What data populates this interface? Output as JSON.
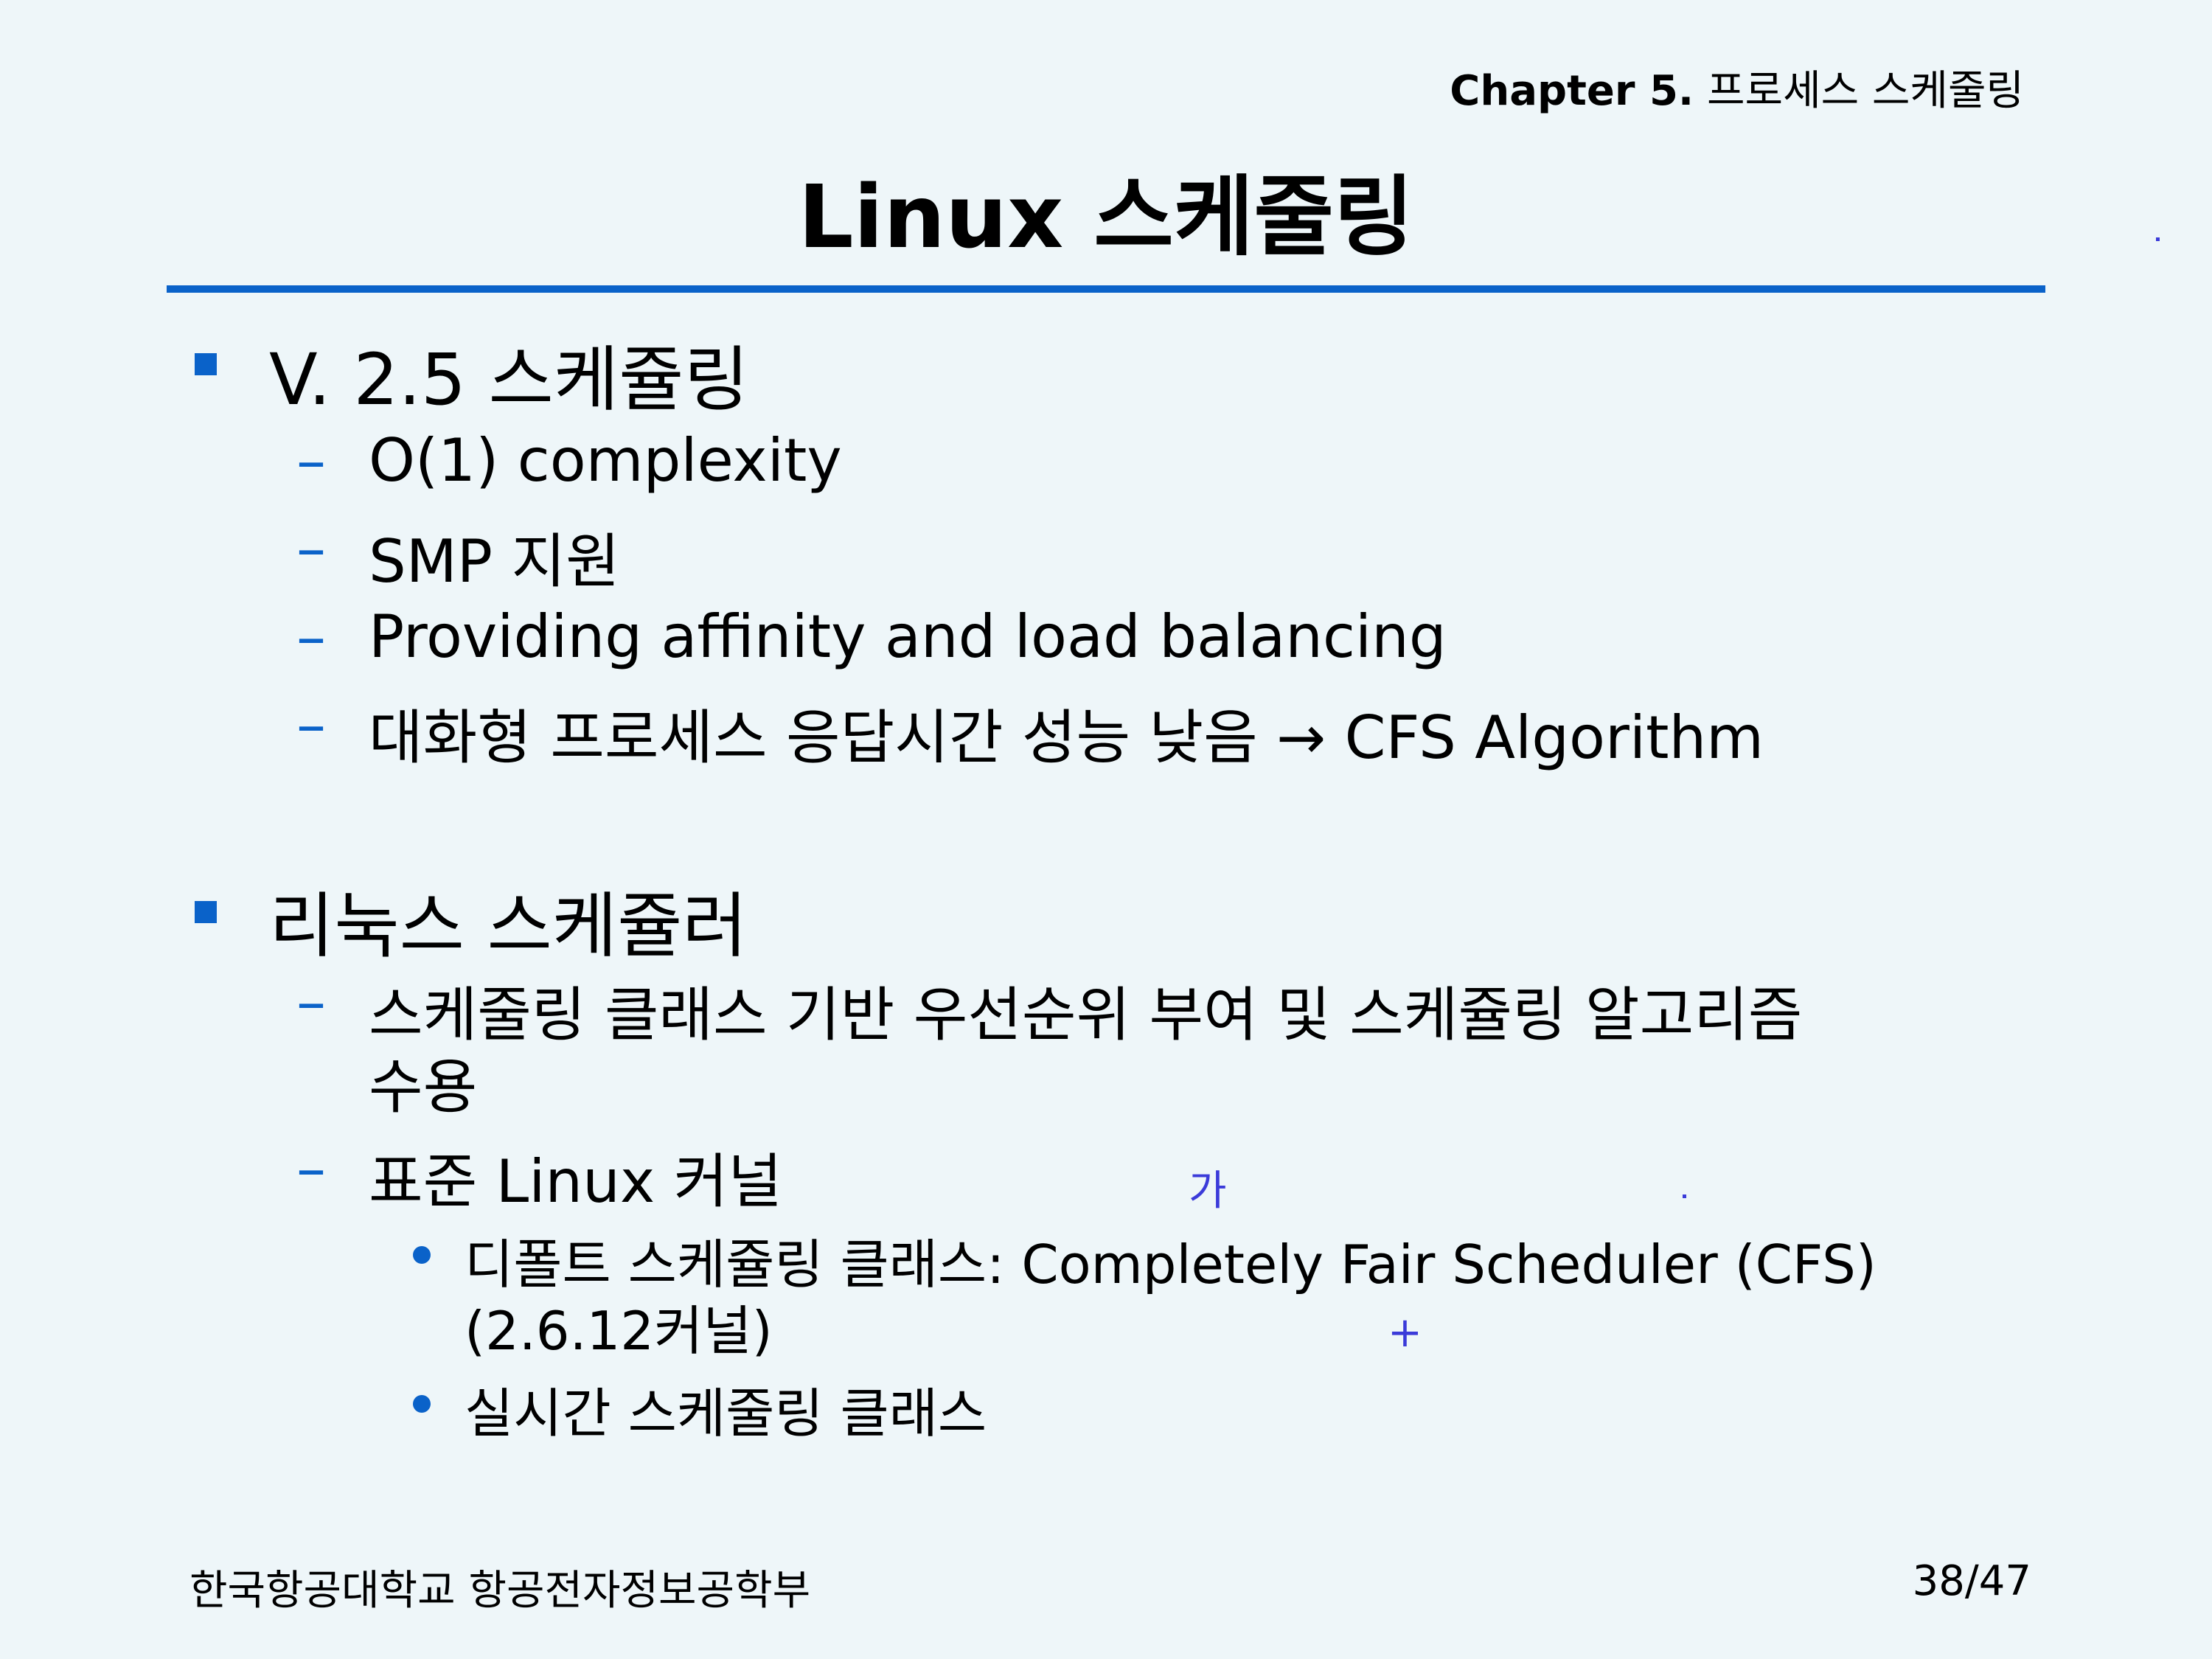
{
  "header": {
    "chapter_label": "Chapter 5.",
    "chapter_title": "프로세스 스케줄링"
  },
  "slide": {
    "title": "Linux 스케줄링",
    "sections": [
      {
        "heading": "V. 2.5 스케쥴링",
        "items": [
          "O(1) complexity",
          "SMP 지원",
          "Providing affinity and load balancing",
          "대화형 프로세스 응답시간 성능 낮음 → CFS Algorithm"
        ]
      },
      {
        "heading": "리눅스 스케쥴러",
        "items": [
          "스케줄링 클래스 기반 우선순위 부여 및 스케쥴링 알고리즘",
          "수용",
          "표준 Linux 커널"
        ],
        "subitems": [
          "디폴트 스케쥴링 클래스: Completely Fair Scheduler (CFS)",
          "(2.6.12커널)",
          "실시간 스케줄링 클래스"
        ]
      }
    ]
  },
  "marks": {
    "ga": "가",
    "plus": "+"
  },
  "footer": {
    "school": "한국항공대학교 항공전자정보공학부",
    "page": "38/47"
  },
  "colors": {
    "accent": "#0a62c9",
    "background": "#eef6f9",
    "mark": "#3b3bd9"
  }
}
